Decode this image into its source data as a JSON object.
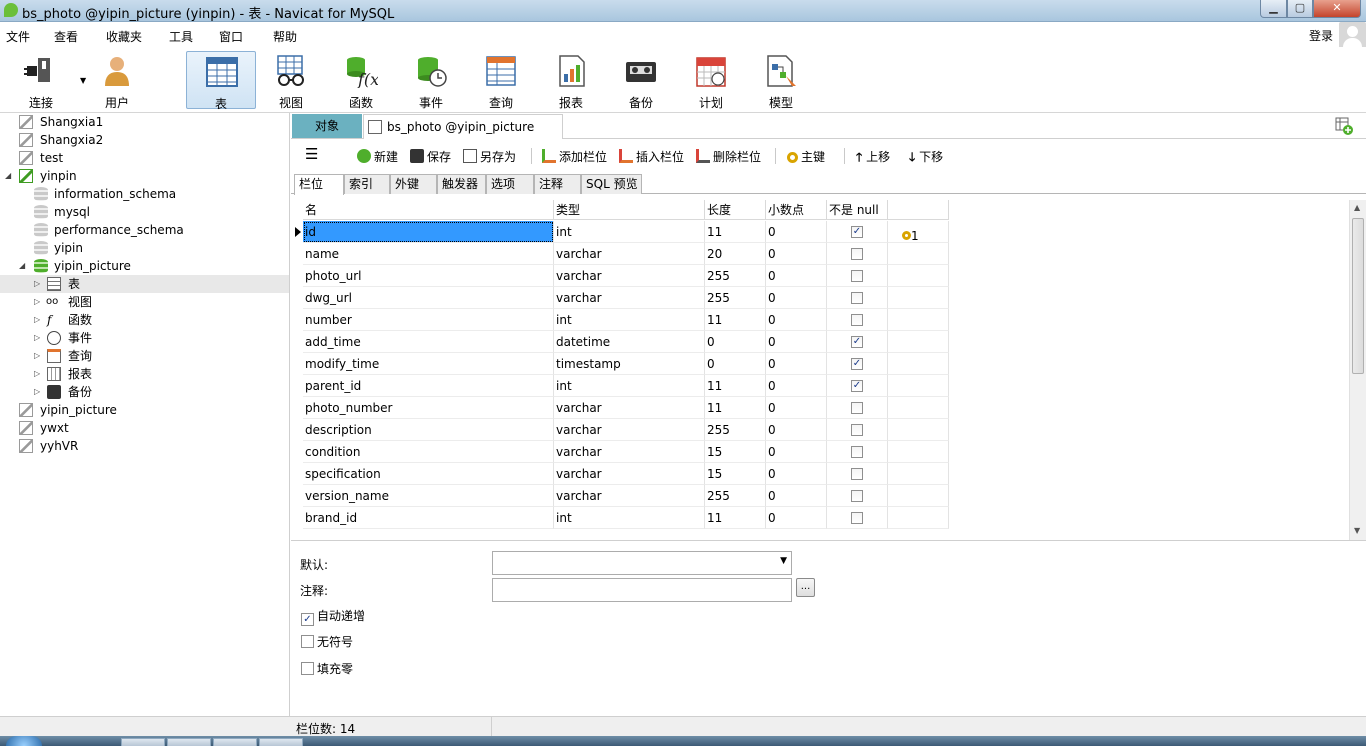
{
  "window": {
    "title": "bs_photo @yipin_picture (yinpin) - 表 - Navicat for MySQL",
    "min_glyph": "▁",
    "max_glyph": "▢",
    "close_glyph": "✕"
  },
  "menu": {
    "items": [
      "文件",
      "查看",
      "收藏夹",
      "工具",
      "窗口",
      "帮助"
    ],
    "login": "登录"
  },
  "toolbar": {
    "items": [
      {
        "label": "连接",
        "icon": "plug-icon"
      },
      {
        "label": "用户",
        "icon": "user-icon"
      },
      {
        "label": "表",
        "icon": "table-icon",
        "active": true
      },
      {
        "label": "视图",
        "icon": "glasses-icon"
      },
      {
        "label": "函数",
        "icon": "function-icon"
      },
      {
        "label": "事件",
        "icon": "event-clock-icon"
      },
      {
        "label": "查询",
        "icon": "query-icon"
      },
      {
        "label": "报表",
        "icon": "report-icon"
      },
      {
        "label": "备份",
        "icon": "backup-tape-icon"
      },
      {
        "label": "计划",
        "icon": "calendar-icon"
      },
      {
        "label": "模型",
        "icon": "model-icon"
      }
    ]
  },
  "tree": {
    "nodes": [
      {
        "label": "Shangxia1",
        "type": "connection",
        "depth": 0
      },
      {
        "label": "Shangxia2",
        "type": "connection",
        "depth": 0
      },
      {
        "label": "test",
        "type": "connection",
        "depth": 0
      },
      {
        "label": "yinpin",
        "type": "connection-open",
        "depth": 0,
        "expanded": true
      },
      {
        "label": "information_schema",
        "type": "database",
        "depth": 1
      },
      {
        "label": "mysql",
        "type": "database",
        "depth": 1
      },
      {
        "label": "performance_schema",
        "type": "database",
        "depth": 1
      },
      {
        "label": "yipin",
        "type": "database",
        "depth": 1
      },
      {
        "label": "yipin_picture",
        "type": "database-open",
        "depth": 1,
        "expanded": true
      },
      {
        "label": "表",
        "type": "tables",
        "depth": 2,
        "selected": true
      },
      {
        "label": "视图",
        "type": "views",
        "depth": 2
      },
      {
        "label": "函数",
        "type": "functions",
        "depth": 2
      },
      {
        "label": "事件",
        "type": "events",
        "depth": 2
      },
      {
        "label": "查询",
        "type": "queries",
        "depth": 2
      },
      {
        "label": "报表",
        "type": "reports",
        "depth": 2
      },
      {
        "label": "备份",
        "type": "backups",
        "depth": 2
      },
      {
        "label": "yipin_picture",
        "type": "connection",
        "depth": 0
      },
      {
        "label": "ywxt",
        "type": "connection",
        "depth": 0
      },
      {
        "label": "yyhVR",
        "type": "connection",
        "depth": 0
      }
    ]
  },
  "tabs": {
    "objects": "对象",
    "document": "bs_photo @yipin_picture (yi..."
  },
  "editor_toolbar": {
    "menu_glyph": "☰",
    "new": "新建",
    "save": "保存",
    "save_as": "另存为",
    "add_field": "添加栏位",
    "insert_field": "插入栏位",
    "delete_field": "删除栏位",
    "primary_key": "主键",
    "move_up": "上移",
    "move_down": "下移"
  },
  "sub_tabs": [
    "栏位",
    "索引",
    "外键",
    "触发器",
    "选项",
    "注释",
    "SQL 预览"
  ],
  "grid": {
    "headers": [
      "名",
      "类型",
      "长度",
      "小数点",
      "不是 null",
      ""
    ],
    "rows": [
      {
        "name": "id",
        "type": "int",
        "length": "11",
        "decimals": "0",
        "not_null": true,
        "key": "1"
      },
      {
        "name": "name",
        "type": "varchar",
        "length": "20",
        "decimals": "0",
        "not_null": false,
        "key": ""
      },
      {
        "name": "photo_url",
        "type": "varchar",
        "length": "255",
        "decimals": "0",
        "not_null": false,
        "key": ""
      },
      {
        "name": "dwg_url",
        "type": "varchar",
        "length": "255",
        "decimals": "0",
        "not_null": false,
        "key": ""
      },
      {
        "name": "number",
        "type": "int",
        "length": "11",
        "decimals": "0",
        "not_null": false,
        "key": ""
      },
      {
        "name": "add_time",
        "type": "datetime",
        "length": "0",
        "decimals": "0",
        "not_null": true,
        "key": ""
      },
      {
        "name": "modify_time",
        "type": "timestamp",
        "length": "0",
        "decimals": "0",
        "not_null": true,
        "key": ""
      },
      {
        "name": "parent_id",
        "type": "int",
        "length": "11",
        "decimals": "0",
        "not_null": true,
        "key": ""
      },
      {
        "name": "photo_number",
        "type": "varchar",
        "length": "11",
        "decimals": "0",
        "not_null": false,
        "key": ""
      },
      {
        "name": "description",
        "type": "varchar",
        "length": "255",
        "decimals": "0",
        "not_null": false,
        "key": ""
      },
      {
        "name": "condition",
        "type": "varchar",
        "length": "15",
        "decimals": "0",
        "not_null": false,
        "key": ""
      },
      {
        "name": "specification",
        "type": "varchar",
        "length": "15",
        "decimals": "0",
        "not_null": false,
        "key": ""
      },
      {
        "name": "version_name",
        "type": "varchar",
        "length": "255",
        "decimals": "0",
        "not_null": false,
        "key": ""
      },
      {
        "name": "brand_id",
        "type": "int",
        "length": "11",
        "decimals": "0",
        "not_null": false,
        "key": ""
      }
    ]
  },
  "properties": {
    "default_label": "默认:",
    "default_value": "",
    "comment_label": "注释:",
    "comment_value": "",
    "dots": "...",
    "auto_increment": {
      "label": "自动递增",
      "checked": true
    },
    "unsigned": {
      "label": "无符号",
      "checked": false
    },
    "zerofill": {
      "label": "填充零",
      "checked": false
    }
  },
  "status": {
    "field_count": "栏位数: 14"
  },
  "colors": {
    "selection": "#3399ff",
    "objects_tab": "#6bb1c0",
    "connection_active": "#3f9c22",
    "key": "#d9a400"
  }
}
